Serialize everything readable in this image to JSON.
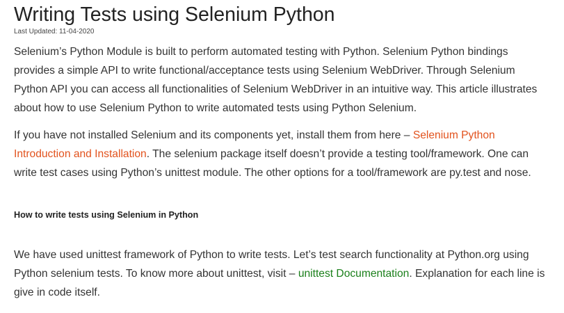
{
  "article": {
    "title": "Writing Tests using Selenium Python",
    "last_updated": "Last Updated: 11-04-2020",
    "paragraph1": "Selenium’s Python Module is built to perform automated testing with Python. Selenium Python bindings provides a simple API to write functional/acceptance tests using Selenium WebDriver. Through Selenium Python API you can access all functionalities of Selenium WebDriver in an intuitive way. This article illustrates about how to use Selenium Python to write automated tests using Python Selenium.",
    "paragraph2": {
      "text_before": "If you have not installed Selenium and its components yet, install them from here – ",
      "link_text": "Selenium Python Introduction and Installation",
      "text_after": ". The selenium package itself doesn’t provide a testing tool/framework. One can write test cases using Python’s unittest module. The other options for a tool/framework are py.test and nose."
    },
    "section_heading": "How to write tests using Selenium in Python",
    "paragraph3": {
      "text_before": "We have used unittest framework of Python to write tests. Let’s test search functionality at Python.org using Python selenium tests. To know more about unittest, visit – ",
      "link_text": "unittest Documentation",
      "text_after": ". Explanation for each line is give in code itself."
    }
  },
  "colors": {
    "link_orange": "#e2521d",
    "link_green": "#1a7f1a",
    "text": "#333333"
  }
}
